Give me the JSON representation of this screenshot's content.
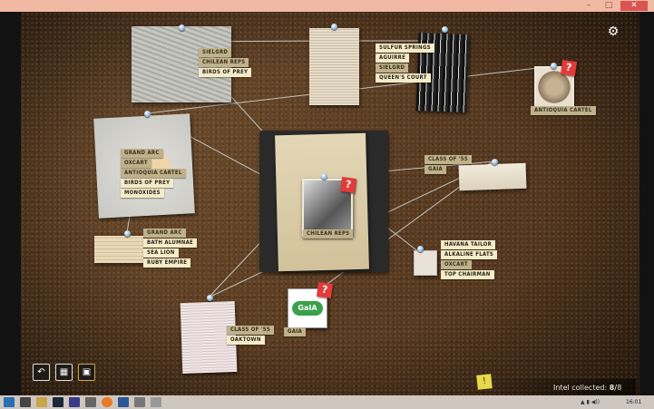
{
  "window": {
    "minimize": "–",
    "maximize": "□",
    "close": "✕"
  },
  "settings_icon": "gear-icon",
  "tags": {
    "map_top": [
      "Sielgrd",
      "Chilean Reps",
      "Birds of Prey"
    ],
    "newspaper": [
      "Sulfur Springs",
      "Aguirre",
      "Sielgrd",
      "Queen's Court"
    ],
    "map_left": [
      "Grand Arc",
      "Oxcart",
      "Antioquia Cartel",
      "Birds of Prey",
      "Monoxides"
    ],
    "note_left": [
      "Grand Arc",
      "Bath Alumnae",
      "Sea Lion",
      "Ruby Empire"
    ],
    "card_right": [
      "Class of '55",
      "Gaia"
    ],
    "photo_right": [
      "Havana Tailor",
      "Alkaline Flats",
      "Oxcart",
      "Top Chairman"
    ],
    "document_bottom": [
      "Class of '55",
      "Oaktown"
    ]
  },
  "labels": {
    "antioquia": "Antioquia Cartel",
    "chilean": "Chilean Reps",
    "gaia": "Gaia"
  },
  "gaia_logo": "GaIA",
  "question_mark": "?",
  "intel": {
    "label": "Intel collected:",
    "value": "8/",
    "total": "8"
  },
  "taskbar": {
    "time": "16:01"
  }
}
